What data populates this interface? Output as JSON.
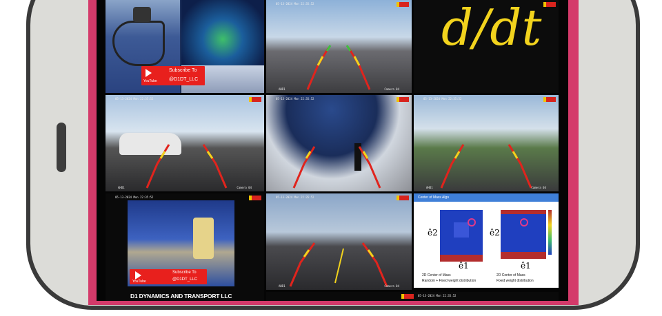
{
  "brand": {
    "name": "D1 DYNAMICS AND TRANSPORT LLC"
  },
  "youtube": {
    "subscribe": "Subscribe To",
    "handle": "@D1DT_LLC",
    "label": "YouTube"
  },
  "dashcam": {
    "timestamps": [
      "05-13-2024 Mon 22:35:52",
      "05-13-2024 Mon 22:35:52",
      "05-13-2024 Mon 22:35:52",
      "05-13-2024 Mon 22:35:52",
      "05-13-2024 Mon 22:35:52",
      "05-13-2024 Mon 22:35:52",
      "05-13-2024 Mon 22:35:52"
    ],
    "left_label": "AHD1",
    "right_label": "Camera 04"
  },
  "handwriting": {
    "text": "d/dt"
  },
  "center_of_mass": {
    "title": "Center of Mass Algo",
    "axis_y": "ê2",
    "axis_x": "ê1",
    "caption_title": "2D Center of Mass",
    "left_caption": "Random + Fixed weight distribution",
    "right_caption": "Fixed weight distribution"
  },
  "colors": {
    "frame": "#d43a6a",
    "guide_red": "#e0241d",
    "guide_yellow": "#f2d31d",
    "guide_green": "#3fbf3f"
  }
}
